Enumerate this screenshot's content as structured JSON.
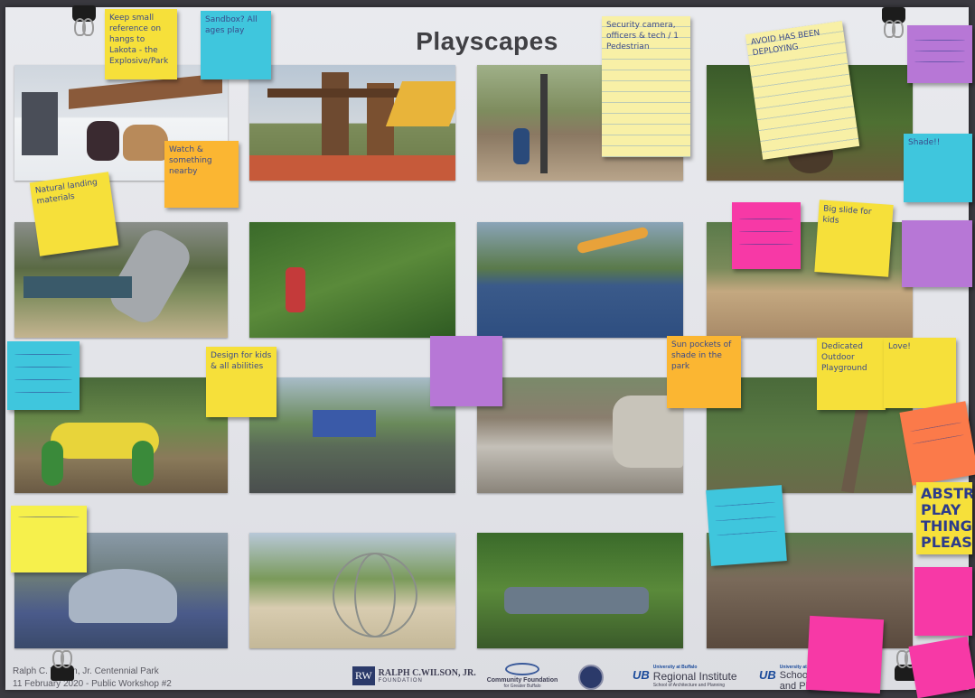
{
  "board": {
    "title": "Playscapes",
    "background_color": "#e6e7eb"
  },
  "sticky_notes": [
    {
      "id": "n1",
      "color": "#f6e03a",
      "text": "Keep small reference on hangs to Lakota - the Explosive/Park"
    },
    {
      "id": "n2",
      "color": "#3fc6dd",
      "text": "Sandbox? All ages play"
    },
    {
      "id": "n3",
      "color": "#f8f0a6",
      "text": "Security camera, officers & tech / 1 Pedestrian"
    },
    {
      "id": "n4",
      "color": "#f8f0a6",
      "text": "AVOID HAS BEEN DEPLOYING"
    },
    {
      "id": "n5",
      "color": "#b777d6",
      "text": ""
    },
    {
      "id": "n6",
      "color": "#fbb632",
      "text": "Watch & something nearby"
    },
    {
      "id": "n7",
      "color": "#f6e03a",
      "text": "Natural landing materials"
    },
    {
      "id": "n8",
      "color": "#3fc6dd",
      "text": "Shade!!"
    },
    {
      "id": "n9",
      "color": "#f739a6",
      "text": ""
    },
    {
      "id": "n10",
      "color": "#f6e03a",
      "text": "Big slide for kids"
    },
    {
      "id": "n11",
      "color": "#b777d6",
      "text": ""
    },
    {
      "id": "n12",
      "color": "#3fc6dd",
      "text": ""
    },
    {
      "id": "n13",
      "color": "#f6e03a",
      "text": "Design for kids & all abilities"
    },
    {
      "id": "n14",
      "color": "#b777d6",
      "text": ""
    },
    {
      "id": "n15",
      "color": "#fbb632",
      "text": "Sun pockets of shade in the park"
    },
    {
      "id": "n16",
      "color": "#f6e03a",
      "text": "Dedicated Outdoor Playground"
    },
    {
      "id": "n17",
      "color": "#f6e03a",
      "text": "Love!"
    },
    {
      "id": "n18",
      "color": "#fb7a4a",
      "text": ""
    },
    {
      "id": "n19",
      "color": "#f6e03a",
      "text": "ABSTRACT PLAY THING PLEASE!"
    },
    {
      "id": "n20",
      "color": "#f6f04c",
      "text": ""
    },
    {
      "id": "n21",
      "color": "#3fc6dd",
      "text": ""
    },
    {
      "id": "n22",
      "color": "#f739a6",
      "text": ""
    },
    {
      "id": "n23",
      "color": "#f739a6",
      "text": ""
    },
    {
      "id": "n24",
      "color": "#f739a6",
      "text": ""
    }
  ],
  "footer": {
    "park_name": "Ralph C. Wilson, Jr. Centennial Park",
    "event": "11 February 2020 - Public Workshop #2",
    "logos": [
      {
        "mark": "RW",
        "name": "RALPH C.WILSON, JR.",
        "sub": "FOUNDATION"
      },
      {
        "name": "Community Foundation",
        "sub": "for Greater Buffalo"
      },
      {
        "name": "City seal"
      },
      {
        "mark": "UB",
        "top": "University at Buffalo",
        "name": "Regional Institute",
        "sub": "School of Architecture and Planning"
      },
      {
        "mark": "UB",
        "top": "University at Buffalo",
        "name": "School of",
        "sub": "and Pla"
      }
    ]
  }
}
